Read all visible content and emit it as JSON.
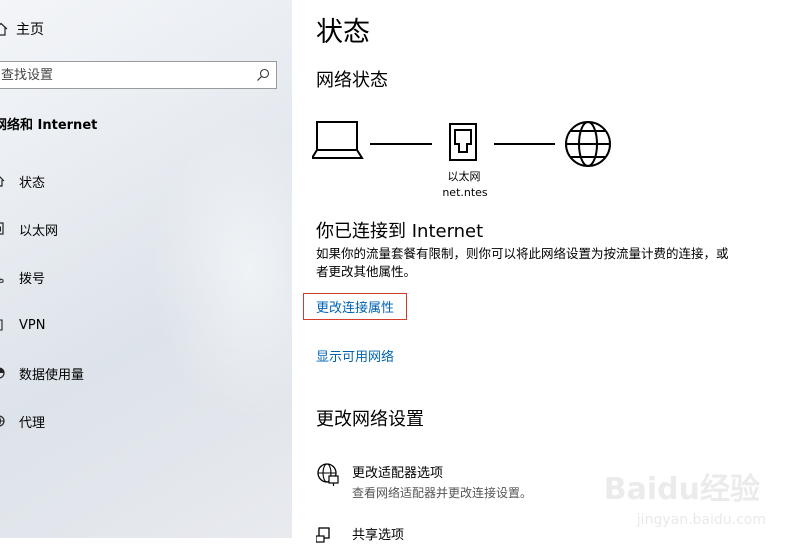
{
  "sidebar": {
    "home_label": "主页",
    "search_placeholder": "查找设置",
    "section_title": "网络和 Internet",
    "items": [
      {
        "label": "状态",
        "icon": "home-status-icon"
      },
      {
        "label": "以太网",
        "icon": "ethernet-icon"
      },
      {
        "label": "拨号",
        "icon": "dialup-icon"
      },
      {
        "label": "VPN",
        "icon": "vpn-icon"
      },
      {
        "label": "数据使用量",
        "icon": "data-usage-icon"
      },
      {
        "label": "代理",
        "icon": "proxy-icon"
      }
    ]
  },
  "main": {
    "title": "状态",
    "network_status_title": "网络状态",
    "diagram": {
      "adapter_label": "以太网",
      "adapter_host": "net.ntes"
    },
    "connected_title": "你已连接到 Internet",
    "connected_desc": "如果你的流量套餐有限制，则你可以将此网络设置为按流量计费的连接，或者更改其他属性。",
    "change_props_link": "更改连接属性",
    "show_networks_link": "显示可用网络",
    "change_settings_title": "更改网络设置",
    "settings": [
      {
        "title": "更改适配器选项",
        "desc": "查看网络适配器并更改连接设置。",
        "icon": "adapter-globe-icon"
      },
      {
        "title": "共享选项",
        "desc": "",
        "icon": "sharing-icon"
      }
    ],
    "accent_color": "#0063b1",
    "highlight_color": "#d23c2a"
  },
  "watermark": {
    "brand": "Baidu经验",
    "url": "jingyan.baidu.com"
  }
}
